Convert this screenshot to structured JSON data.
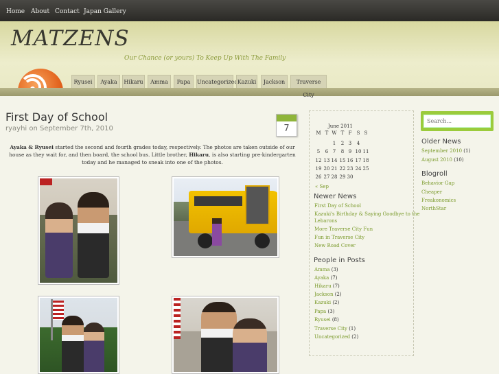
{
  "topnav": [
    "Home",
    "About",
    "Contact",
    "Japan Gallery"
  ],
  "header": {
    "title": "MATZENS",
    "tagline": "Our Chance (or yours) To Keep Up With The Family"
  },
  "categories": [
    "Ryusei",
    "Ayaka",
    "Hikaru",
    "Amma",
    "Papa",
    "Uncategorized",
    "Kazuki",
    "Jackson",
    "Traverse City"
  ],
  "post": {
    "title": "First Day of School",
    "meta": "ryayhi on September 7th, 2010",
    "date_day": "7",
    "body_names_bold": "Ayaka & Ryusei",
    "body_part1": " started the second and fourth grades today, respectively.  The photos are taken outside of our house as they wait for, and then board, the school bus.  Little brother, ",
    "body_name2": "Hikaru",
    "body_part2": ", is also starting pre-kindergarten today and he managed to sneak into one of the photos."
  },
  "calendar": {
    "caption": "June 2011",
    "weekdays": [
      "M",
      "T",
      "W",
      "T",
      "F",
      "S",
      "S"
    ],
    "rows": [
      [
        "",
        "",
        "1",
        "2",
        "3",
        "4",
        ""
      ],
      [
        "5",
        "6",
        "7",
        "8",
        "9",
        "10",
        "11"
      ],
      [
        "12",
        "13",
        "14",
        "15",
        "16",
        "17",
        "18"
      ],
      [
        "19",
        "20",
        "21",
        "22",
        "23",
        "24",
        "25"
      ],
      [
        "26",
        "27",
        "28",
        "29",
        "30",
        "",
        ""
      ]
    ],
    "prev_link": "« Sep"
  },
  "newer_news": {
    "heading": "Newer News",
    "items": [
      "First Day of School",
      "Kazuki's Birthday & Saying Goodbye to the",
      "Lebarons",
      "More Traverse City Fun",
      "Fun in Traverse City",
      "New Road Cover"
    ]
  },
  "people": {
    "heading": "People in Posts",
    "items": [
      {
        "name": "Amma",
        "count": "(3)"
      },
      {
        "name": "Ayaka",
        "count": "(7)"
      },
      {
        "name": "Hikaru",
        "count": "(7)"
      },
      {
        "name": "Jackson",
        "count": "(2)"
      },
      {
        "name": "Kazuki",
        "count": "(2)"
      },
      {
        "name": "Papa",
        "count": "(3)"
      },
      {
        "name": "Ryusei",
        "count": "(8)"
      },
      {
        "name": "Traverse City",
        "count": "(1)"
      },
      {
        "name": "Uncategorized",
        "count": "(2)"
      }
    ]
  },
  "search": {
    "placeholder": "Search..."
  },
  "older_news": {
    "heading": "Older News",
    "items": [
      {
        "name": "September 2010",
        "count": "(1)"
      },
      {
        "name": "August 2010",
        "count": "(10)"
      }
    ]
  },
  "blogroll": {
    "heading": "Blogroll",
    "items": [
      "Behavior Gap",
      "Cheaper",
      "Freakonomics",
      "NorthStar"
    ]
  },
  "colors": {
    "accent_green": "#9bcb3c",
    "link_green": "#7a9a2a",
    "rss_orange": "#e2621c"
  },
  "icons": [
    "rss-feed-icon"
  ]
}
